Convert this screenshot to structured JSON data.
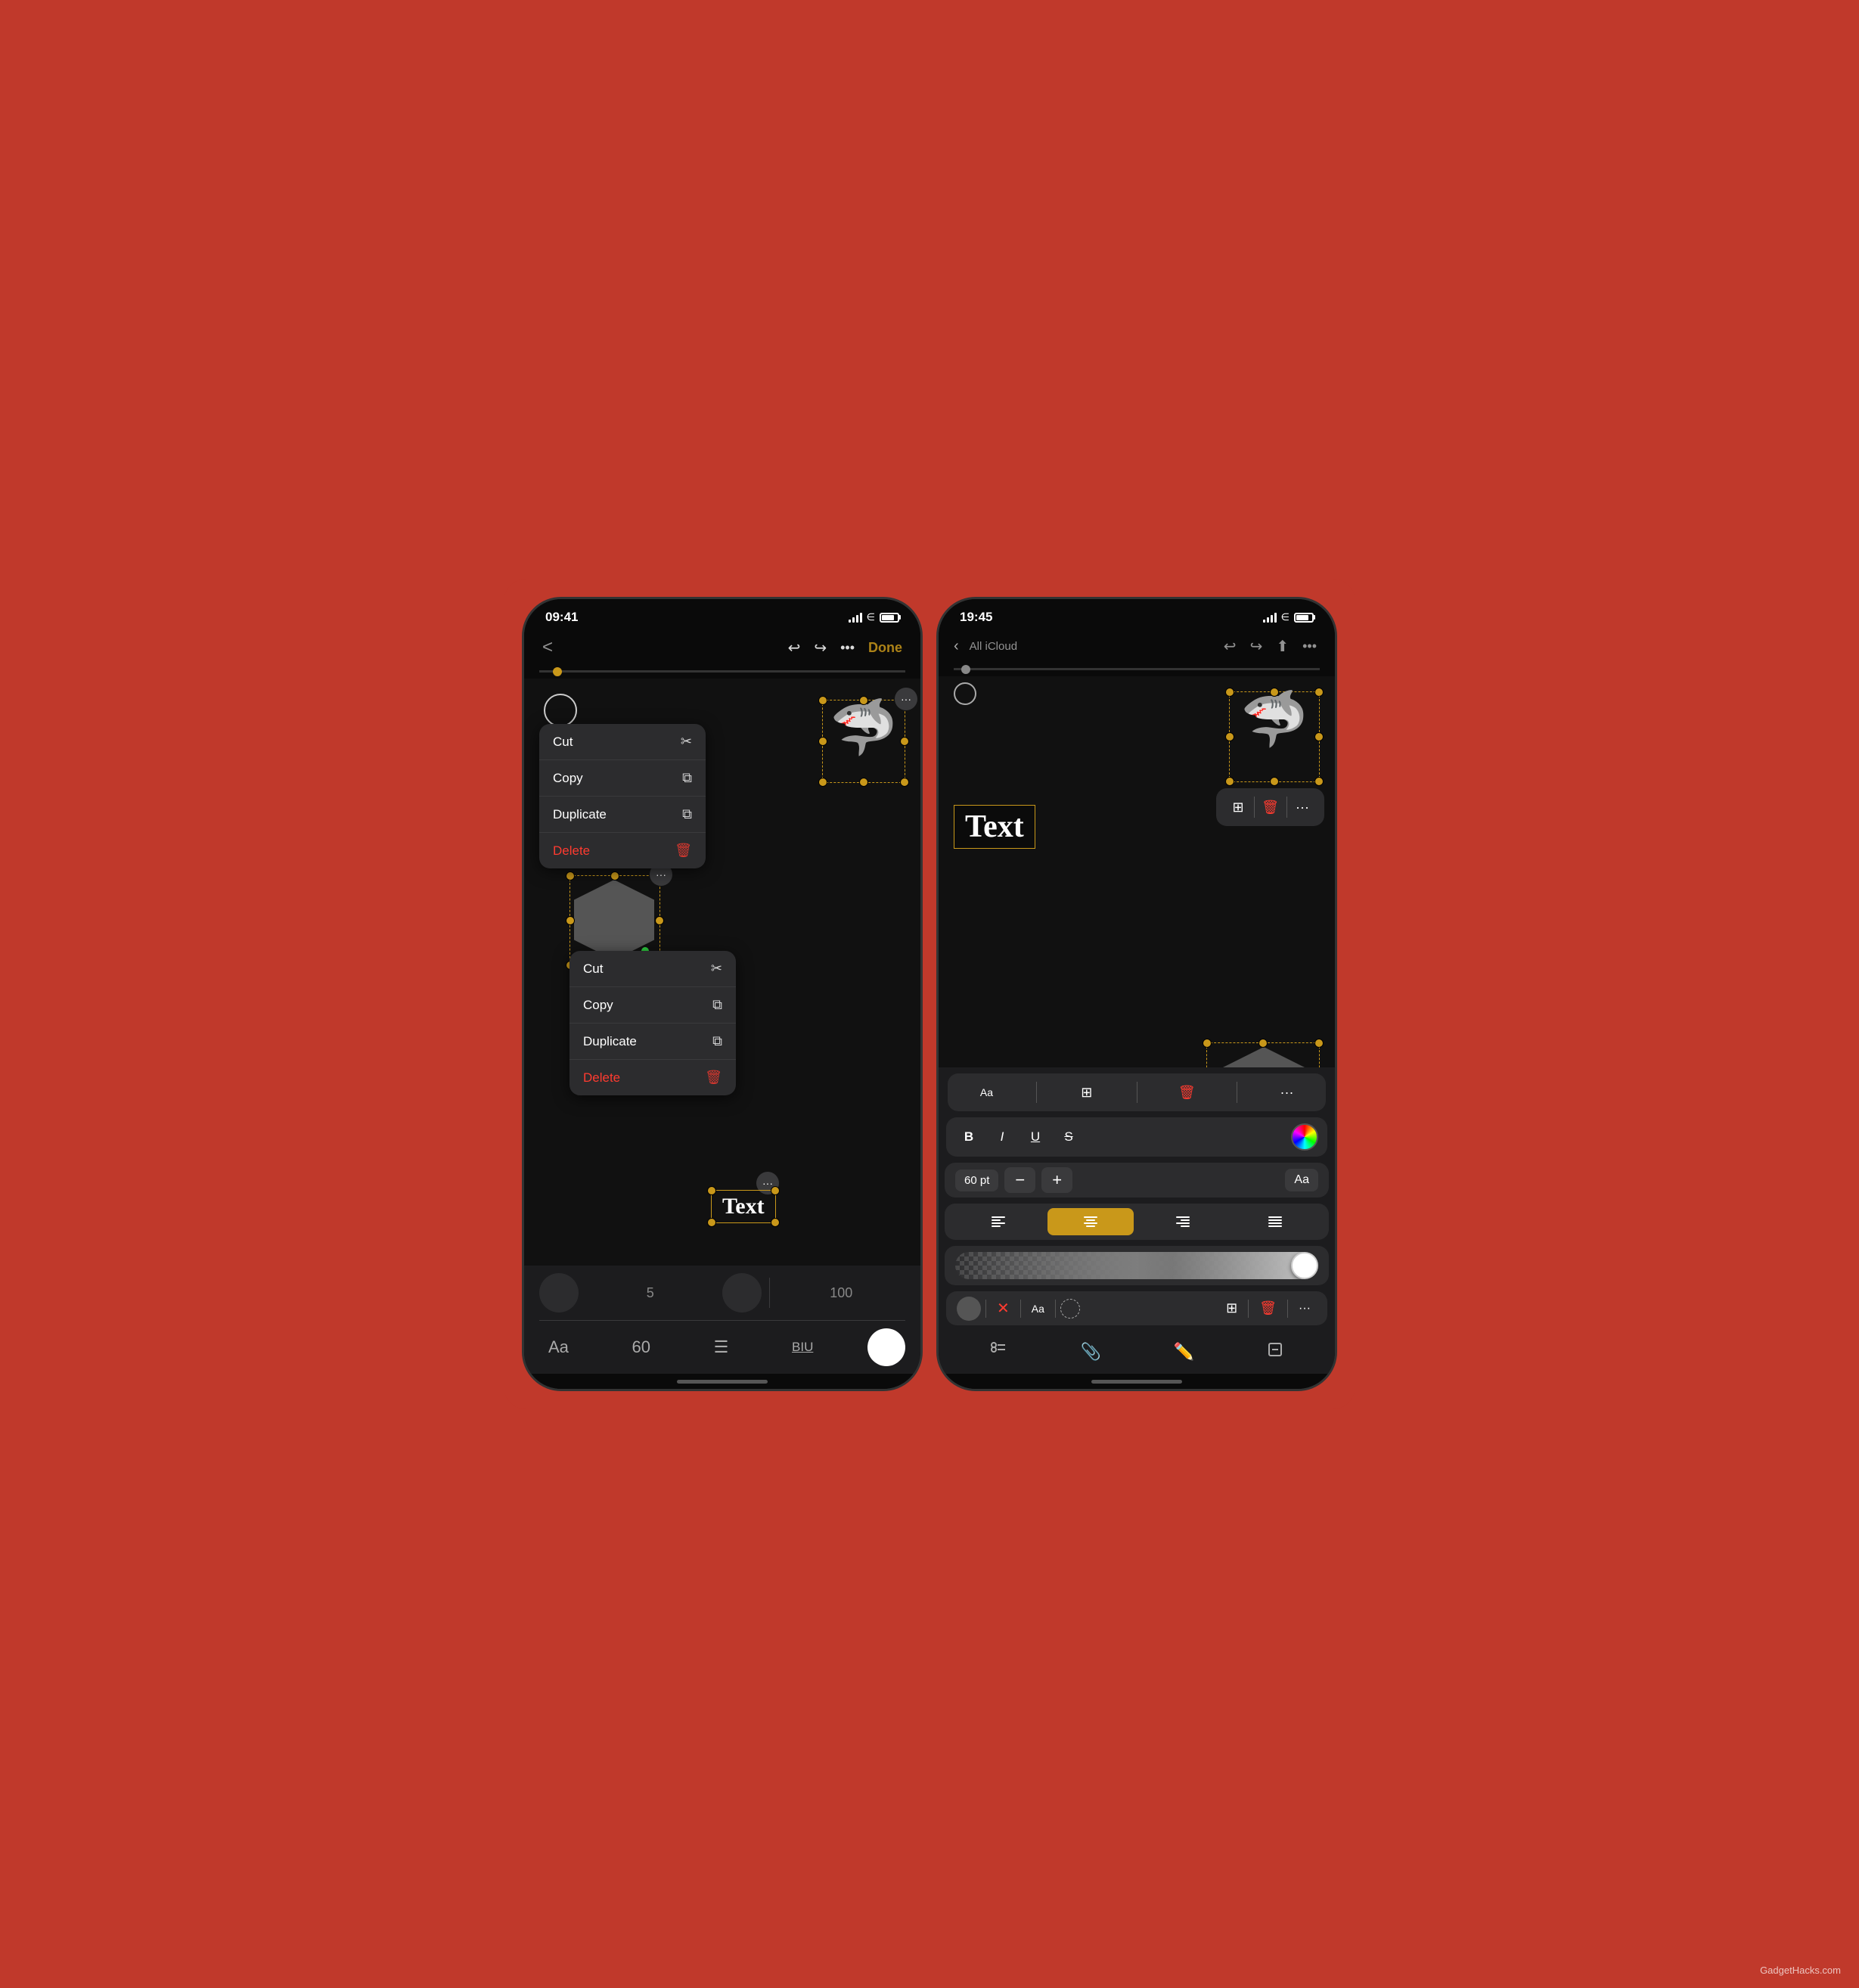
{
  "phone1": {
    "status": {
      "time": "09:41",
      "signal": true,
      "wifi": true,
      "battery": true
    },
    "nav": {
      "back_label": "<",
      "done_label": "Done",
      "undo_icon": "undo",
      "redo_icon": "redo",
      "more_icon": "ellipsis"
    },
    "canvas": {},
    "context_menu_top": {
      "items": [
        {
          "label": "Cut",
          "icon": "✂️",
          "danger": false
        },
        {
          "label": "Copy",
          "icon": "📋",
          "danger": false
        },
        {
          "label": "Duplicate",
          "icon": "📄",
          "danger": false
        },
        {
          "label": "Delete",
          "icon": "🗑️",
          "danger": true
        }
      ]
    },
    "context_menu_bottom": {
      "items": [
        {
          "label": "Cut",
          "icon": "✂️",
          "danger": false
        },
        {
          "label": "Copy",
          "icon": "📋",
          "danger": false
        },
        {
          "label": "Duplicate",
          "icon": "📄",
          "danger": false
        },
        {
          "label": "Delete",
          "icon": "🗑️",
          "danger": true
        }
      ]
    },
    "text_element": "Text",
    "toolbar": {
      "num1": "5",
      "num2": "100",
      "aa_label": "Aa",
      "size_label": "60",
      "biu_label": "BIU"
    }
  },
  "phone2": {
    "status": {
      "time": "19:45",
      "signal": true,
      "wifi": true,
      "battery": true
    },
    "nav": {
      "back_label": "All iCloud",
      "share_icon": "share",
      "more_icon": "ellipsis"
    },
    "text_element": "Text",
    "text_toolbar": {
      "aa_label": "Aa",
      "bold": "B",
      "italic": "I",
      "underline": "U",
      "strikethrough": "S",
      "size_label": "60 pt",
      "size_minus": "−",
      "size_plus": "+",
      "aa_size": "Aa",
      "align_left": "≡",
      "align_center": "≡",
      "align_right": "≡",
      "align_justify": "≡"
    },
    "inline_bar1": {
      "duplicate_icon": "⊕",
      "delete_icon": "🗑",
      "more_icon": "···"
    },
    "inline_bar2": {
      "toggle_icon": "●",
      "close_icon": "✕",
      "aa_icon": "Aa",
      "circle_icon": "○",
      "duplicate_icon": "⊕",
      "delete_icon": "🗑",
      "more_icon": "···"
    }
  },
  "watermark": "GadgetHacks.com"
}
